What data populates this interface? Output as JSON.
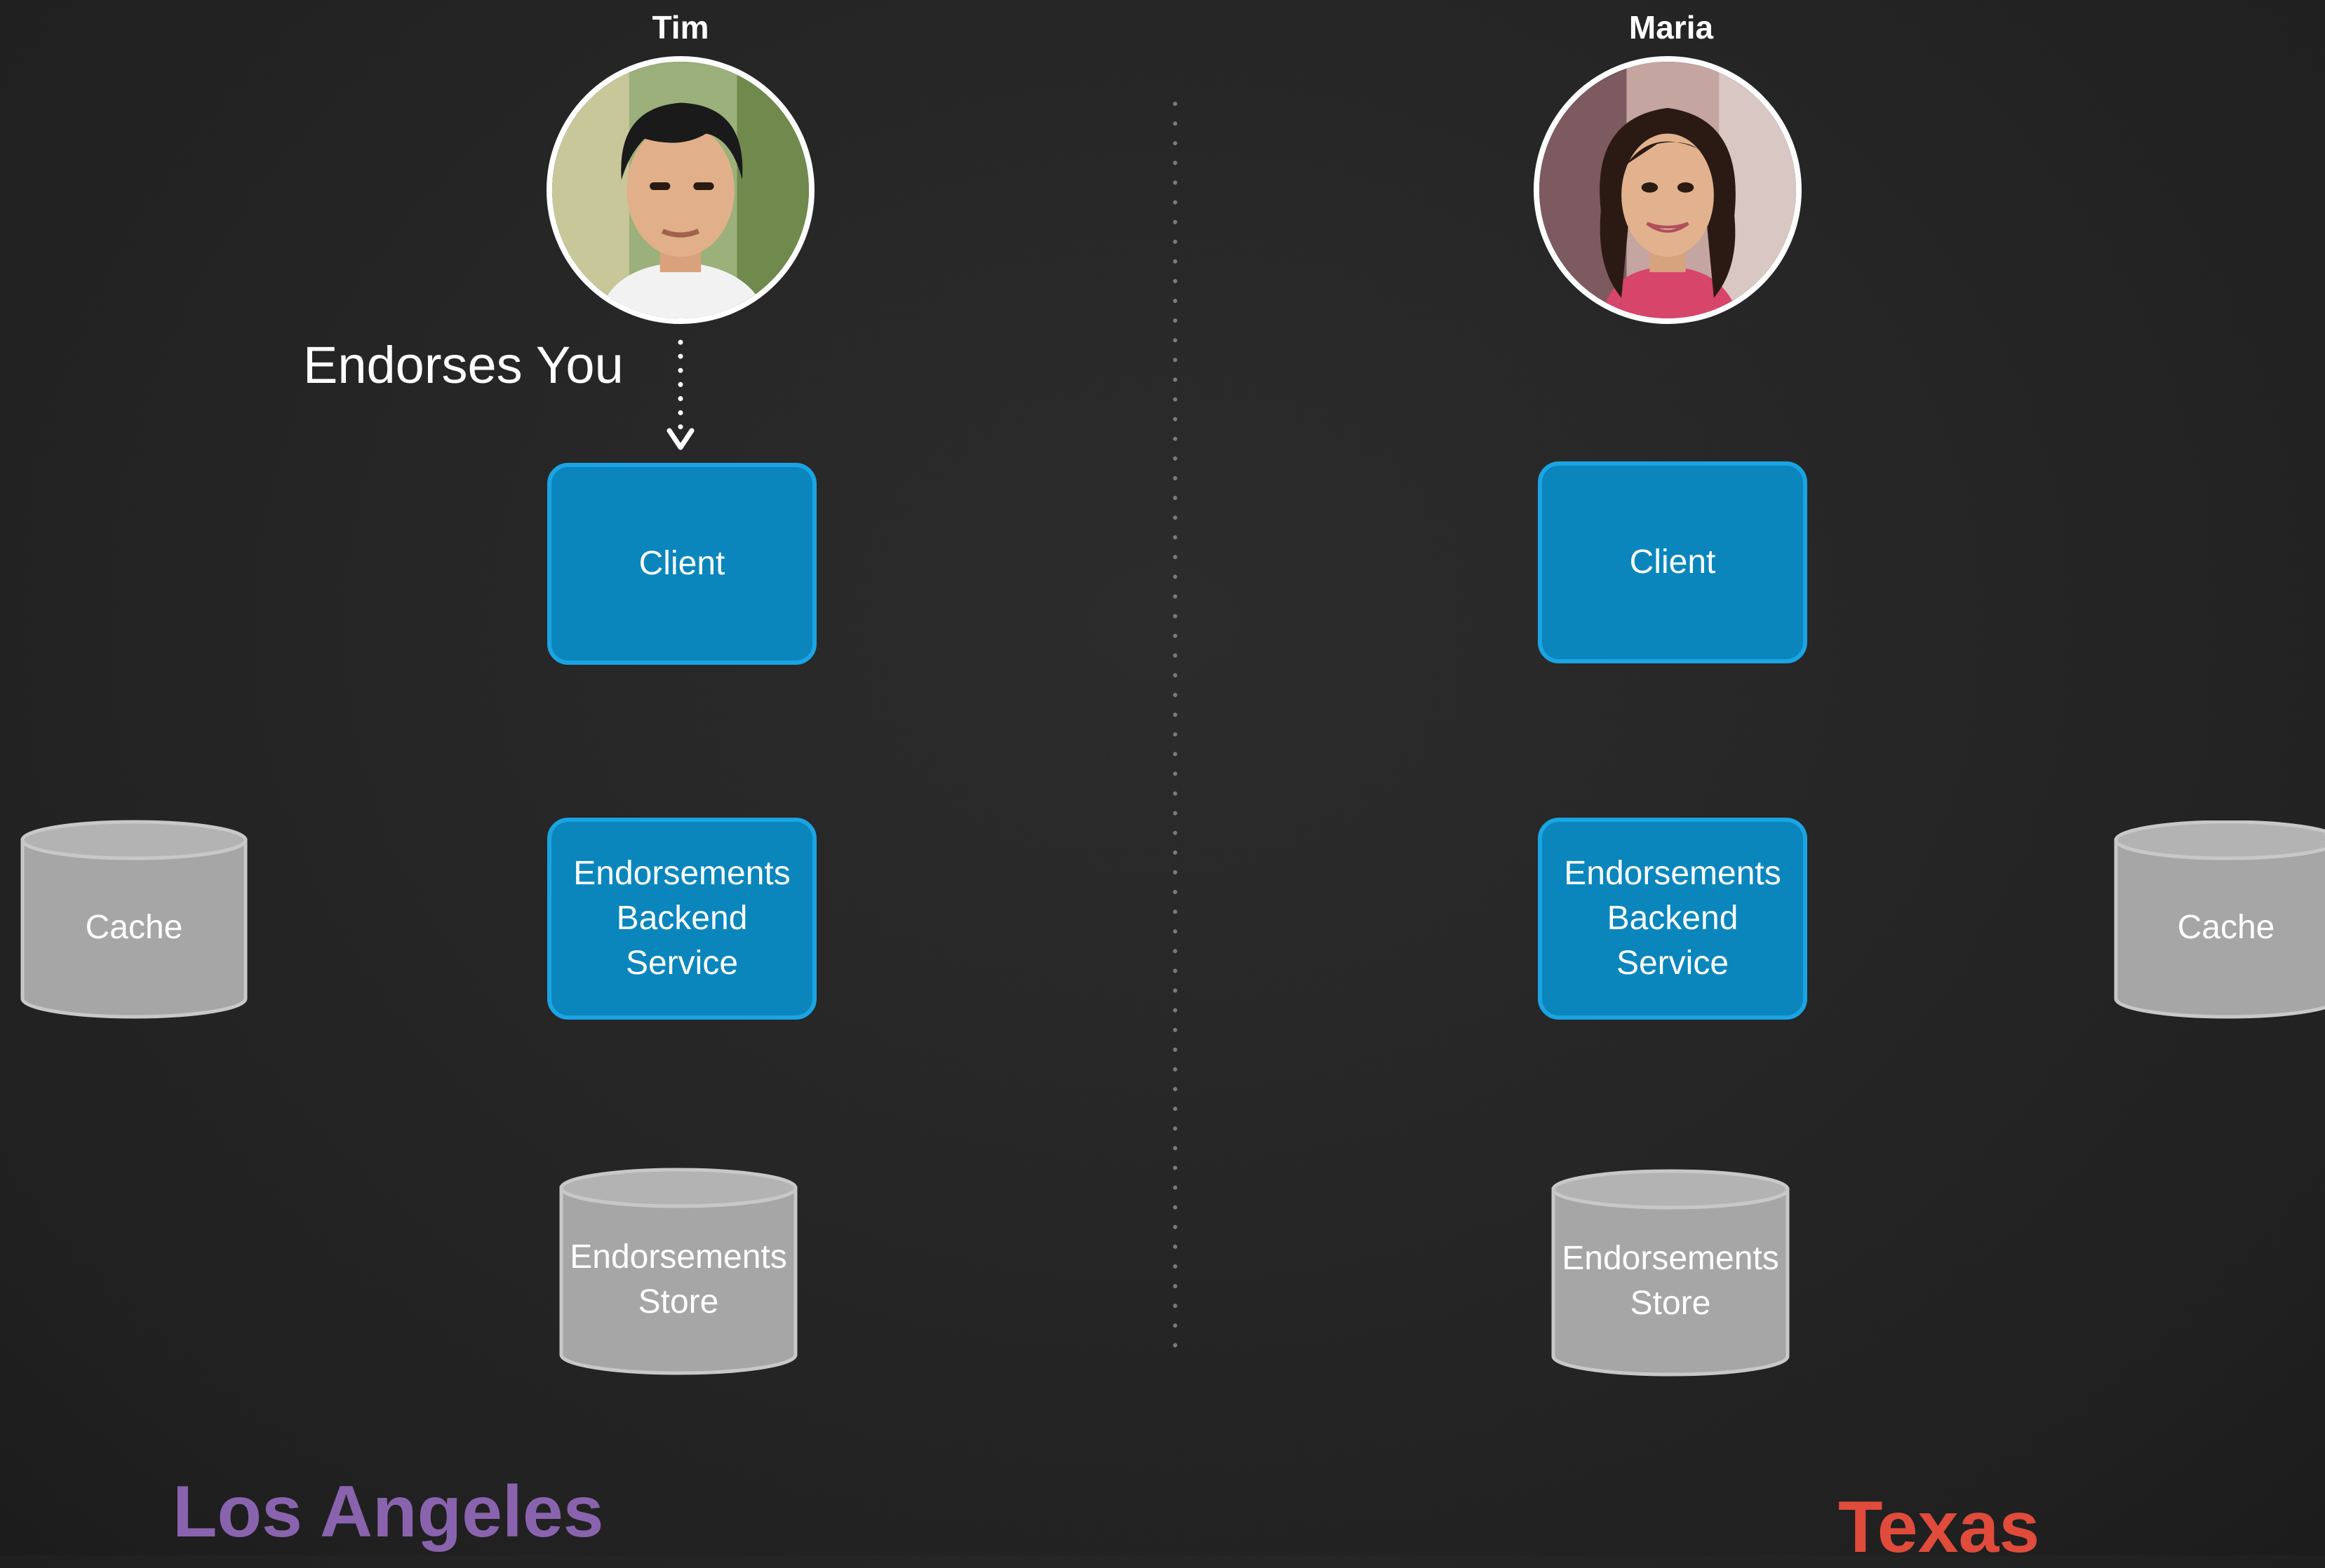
{
  "colors": {
    "node_fill": "#0a86bd",
    "node_border": "#1aa4e3",
    "cylinder_fill": "#a6a6a6",
    "region_la": "#8a63ae",
    "region_tx": "#e04b3b"
  },
  "left": {
    "person": {
      "name": "Tim",
      "avatar": "tim-photo"
    },
    "action_label": "Endorses You",
    "client_label": "Client",
    "backend_label": "Endorsements\nBackend\nService",
    "cache_label": "Cache",
    "store_label": "Endorsements\nStore",
    "region_label": "Los Angeles"
  },
  "right": {
    "person": {
      "name": "Maria",
      "avatar": "maria-photo"
    },
    "client_label": "Client",
    "backend_label": "Endorsements\nBackend\nService",
    "cache_label": "Cache",
    "store_label": "Endorsements\nStore",
    "region_label": "Texas"
  }
}
